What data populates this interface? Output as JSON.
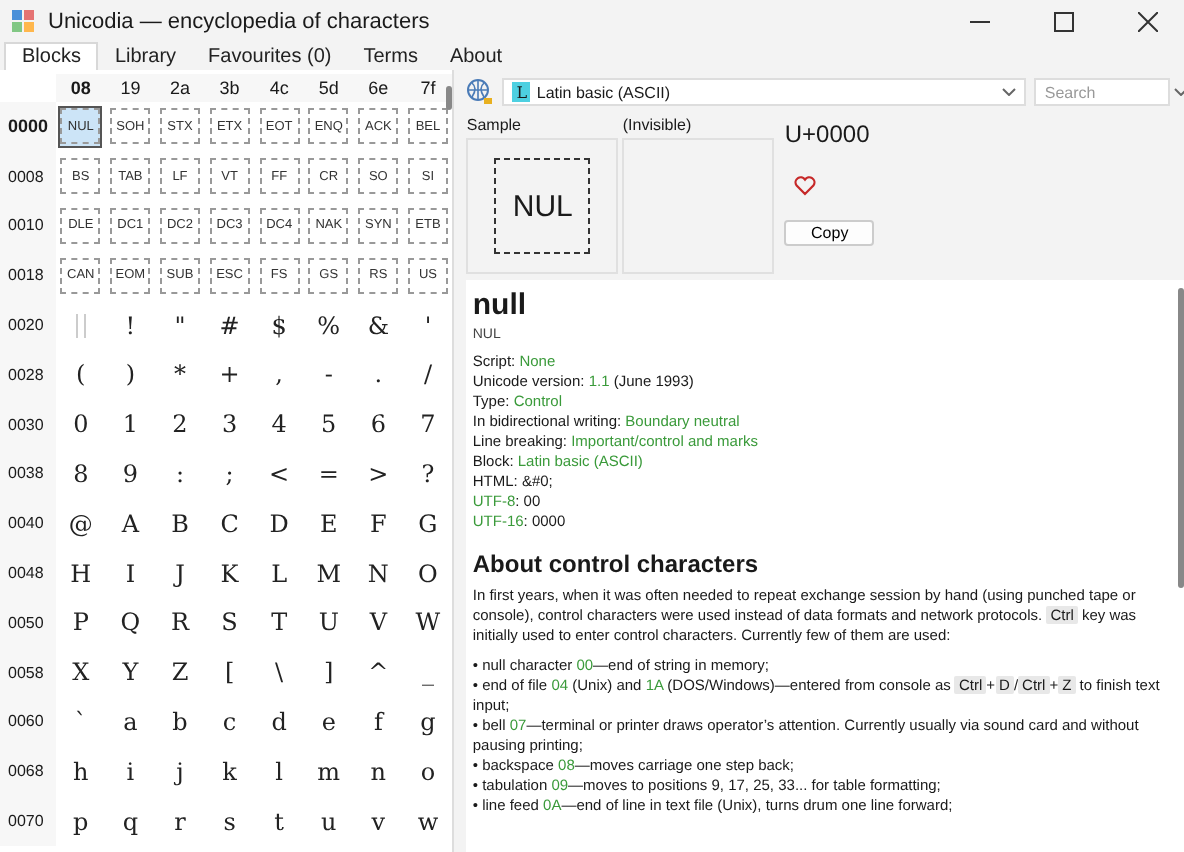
{
  "window": {
    "title": "Unicodia — encyclopedia of characters"
  },
  "tabs": [
    {
      "label": "Blocks",
      "selected": true
    },
    {
      "label": "Library",
      "selected": false
    },
    {
      "label": "Favourites (0)",
      "selected": false
    },
    {
      "label": "Terms",
      "selected": false
    },
    {
      "label": "About",
      "selected": false
    }
  ],
  "grid": {
    "columns": [
      {
        "label": "08",
        "selected": true
      },
      {
        "label": "19",
        "selected": false
      },
      {
        "label": "2a",
        "selected": false
      },
      {
        "label": "3b",
        "selected": false
      },
      {
        "label": "4c",
        "selected": false
      },
      {
        "label": "5d",
        "selected": false
      },
      {
        "label": "6e",
        "selected": false
      },
      {
        "label": "7f",
        "selected": false
      }
    ],
    "rows": [
      {
        "code": "0000",
        "selected": true,
        "cells": [
          {
            "kind": "control",
            "text": "NUL",
            "selected": true
          },
          {
            "kind": "control",
            "text": "SOH",
            "selected": false
          },
          {
            "kind": "control",
            "text": "STX",
            "selected": false
          },
          {
            "kind": "control",
            "text": "ETX",
            "selected": false
          },
          {
            "kind": "control",
            "text": "EOT",
            "selected": false
          },
          {
            "kind": "control",
            "text": "ENQ",
            "selected": false
          },
          {
            "kind": "control",
            "text": "ACK",
            "selected": false
          },
          {
            "kind": "control",
            "text": "BEL",
            "selected": false
          }
        ]
      },
      {
        "code": "0008",
        "selected": false,
        "cells": [
          {
            "kind": "control",
            "text": "BS",
            "selected": false
          },
          {
            "kind": "control",
            "text": "TAB",
            "selected": false
          },
          {
            "kind": "control",
            "text": "LF",
            "selected": false
          },
          {
            "kind": "control",
            "text": "VT",
            "selected": false
          },
          {
            "kind": "control",
            "text": "FF",
            "selected": false
          },
          {
            "kind": "control",
            "text": "CR",
            "selected": false
          },
          {
            "kind": "control",
            "text": "SO",
            "selected": false
          },
          {
            "kind": "control",
            "text": "SI",
            "selected": false
          }
        ]
      },
      {
        "code": "0010",
        "selected": false,
        "cells": [
          {
            "kind": "control",
            "text": "DLE",
            "selected": false
          },
          {
            "kind": "control",
            "text": "DC1",
            "selected": false
          },
          {
            "kind": "control",
            "text": "DC2",
            "selected": false
          },
          {
            "kind": "control",
            "text": "DC3",
            "selected": false
          },
          {
            "kind": "control",
            "text": "DC4",
            "selected": false
          },
          {
            "kind": "control",
            "text": "NAK",
            "selected": false
          },
          {
            "kind": "control",
            "text": "SYN",
            "selected": false
          },
          {
            "kind": "control",
            "text": "ETB",
            "selected": false
          }
        ]
      },
      {
        "code": "0018",
        "selected": false,
        "cells": [
          {
            "kind": "control",
            "text": "CAN",
            "selected": false
          },
          {
            "kind": "control",
            "text": "EOM",
            "selected": false
          },
          {
            "kind": "control",
            "text": "SUB",
            "selected": false
          },
          {
            "kind": "control",
            "text": "ESC",
            "selected": false
          },
          {
            "kind": "control",
            "text": "FS",
            "selected": false
          },
          {
            "kind": "control",
            "text": "GS",
            "selected": false
          },
          {
            "kind": "control",
            "text": "RS",
            "selected": false
          },
          {
            "kind": "control",
            "text": "US",
            "selected": false
          }
        ]
      },
      {
        "code": "0020",
        "selected": false,
        "cells": [
          {
            "kind": "space",
            "selected": false
          },
          {
            "kind": "glyph",
            "text": "!",
            "selected": false
          },
          {
            "kind": "glyph",
            "text": "\"",
            "selected": false
          },
          {
            "kind": "glyph",
            "text": "#",
            "selected": false
          },
          {
            "kind": "glyph",
            "text": "$",
            "selected": false
          },
          {
            "kind": "glyph",
            "text": "%",
            "selected": false
          },
          {
            "kind": "glyph",
            "text": "&",
            "selected": false
          },
          {
            "kind": "glyph",
            "text": "'",
            "selected": false
          }
        ]
      },
      {
        "code": "0028",
        "selected": false,
        "cells": [
          {
            "kind": "glyph",
            "text": "(",
            "selected": false
          },
          {
            "kind": "glyph",
            "text": ")",
            "selected": false
          },
          {
            "kind": "glyph",
            "text": "*",
            "selected": false
          },
          {
            "kind": "glyph",
            "text": "+",
            "selected": false
          },
          {
            "kind": "glyph",
            "text": ",",
            "selected": false
          },
          {
            "kind": "glyph",
            "text": "-",
            "selected": false
          },
          {
            "kind": "glyph",
            "text": ".",
            "selected": false
          },
          {
            "kind": "glyph",
            "text": "/",
            "selected": false
          }
        ]
      },
      {
        "code": "0030",
        "selected": false,
        "cells": [
          {
            "kind": "glyph",
            "text": "0",
            "selected": false
          },
          {
            "kind": "glyph",
            "text": "1",
            "selected": false
          },
          {
            "kind": "glyph",
            "text": "2",
            "selected": false
          },
          {
            "kind": "glyph",
            "text": "3",
            "selected": false
          },
          {
            "kind": "glyph",
            "text": "4",
            "selected": false
          },
          {
            "kind": "glyph",
            "text": "5",
            "selected": false
          },
          {
            "kind": "glyph",
            "text": "6",
            "selected": false
          },
          {
            "kind": "glyph",
            "text": "7",
            "selected": false
          }
        ]
      },
      {
        "code": "0038",
        "selected": false,
        "cells": [
          {
            "kind": "glyph",
            "text": "8",
            "selected": false
          },
          {
            "kind": "glyph",
            "text": "9",
            "selected": false
          },
          {
            "kind": "glyph",
            "text": ":",
            "selected": false
          },
          {
            "kind": "glyph",
            "text": ";",
            "selected": false
          },
          {
            "kind": "glyph",
            "text": "<",
            "selected": false
          },
          {
            "kind": "glyph",
            "text": "=",
            "selected": false
          },
          {
            "kind": "glyph",
            "text": ">",
            "selected": false
          },
          {
            "kind": "glyph",
            "text": "?",
            "selected": false
          }
        ]
      },
      {
        "code": "0040",
        "selected": false,
        "cells": [
          {
            "kind": "glyph",
            "text": "@",
            "selected": false
          },
          {
            "kind": "glyph",
            "text": "A",
            "selected": false
          },
          {
            "kind": "glyph",
            "text": "B",
            "selected": false
          },
          {
            "kind": "glyph",
            "text": "C",
            "selected": false
          },
          {
            "kind": "glyph",
            "text": "D",
            "selected": false
          },
          {
            "kind": "glyph",
            "text": "E",
            "selected": false
          },
          {
            "kind": "glyph",
            "text": "F",
            "selected": false
          },
          {
            "kind": "glyph",
            "text": "G",
            "selected": false
          }
        ]
      },
      {
        "code": "0048",
        "selected": false,
        "cells": [
          {
            "kind": "glyph",
            "text": "H",
            "selected": false
          },
          {
            "kind": "glyph",
            "text": "I",
            "selected": false
          },
          {
            "kind": "glyph",
            "text": "J",
            "selected": false
          },
          {
            "kind": "glyph",
            "text": "K",
            "selected": false
          },
          {
            "kind": "glyph",
            "text": "L",
            "selected": false
          },
          {
            "kind": "glyph",
            "text": "M",
            "selected": false
          },
          {
            "kind": "glyph",
            "text": "N",
            "selected": false
          },
          {
            "kind": "glyph",
            "text": "O",
            "selected": false
          }
        ]
      },
      {
        "code": "0050",
        "selected": false,
        "cells": [
          {
            "kind": "glyph",
            "text": "P",
            "selected": false
          },
          {
            "kind": "glyph",
            "text": "Q",
            "selected": false
          },
          {
            "kind": "glyph",
            "text": "R",
            "selected": false
          },
          {
            "kind": "glyph",
            "text": "S",
            "selected": false
          },
          {
            "kind": "glyph",
            "text": "T",
            "selected": false
          },
          {
            "kind": "glyph",
            "text": "U",
            "selected": false
          },
          {
            "kind": "glyph",
            "text": "V",
            "selected": false
          },
          {
            "kind": "glyph",
            "text": "W",
            "selected": false
          }
        ]
      },
      {
        "code": "0058",
        "selected": false,
        "cells": [
          {
            "kind": "glyph",
            "text": "X",
            "selected": false
          },
          {
            "kind": "glyph",
            "text": "Y",
            "selected": false
          },
          {
            "kind": "glyph",
            "text": "Z",
            "selected": false
          },
          {
            "kind": "glyph",
            "text": "[",
            "selected": false
          },
          {
            "kind": "glyph",
            "text": "\\",
            "selected": false
          },
          {
            "kind": "glyph",
            "text": "]",
            "selected": false
          },
          {
            "kind": "glyph",
            "text": "^",
            "selected": false
          },
          {
            "kind": "glyph",
            "text": "_",
            "selected": false
          }
        ]
      },
      {
        "code": "0060",
        "selected": false,
        "cells": [
          {
            "kind": "glyph",
            "text": "`",
            "selected": false
          },
          {
            "kind": "glyph",
            "text": "a",
            "selected": false
          },
          {
            "kind": "glyph",
            "text": "b",
            "selected": false
          },
          {
            "kind": "glyph",
            "text": "c",
            "selected": false
          },
          {
            "kind": "glyph",
            "text": "d",
            "selected": false
          },
          {
            "kind": "glyph",
            "text": "e",
            "selected": false
          },
          {
            "kind": "glyph",
            "text": "f",
            "selected": false
          },
          {
            "kind": "glyph",
            "text": "g",
            "selected": false
          }
        ]
      },
      {
        "code": "0068",
        "selected": false,
        "cells": [
          {
            "kind": "glyph",
            "text": "h",
            "selected": false
          },
          {
            "kind": "glyph",
            "text": "i",
            "selected": false
          },
          {
            "kind": "glyph",
            "text": "j",
            "selected": false
          },
          {
            "kind": "glyph",
            "text": "k",
            "selected": false
          },
          {
            "kind": "glyph",
            "text": "l",
            "selected": false
          },
          {
            "kind": "glyph",
            "text": "m",
            "selected": false
          },
          {
            "kind": "glyph",
            "text": "n",
            "selected": false
          },
          {
            "kind": "glyph",
            "text": "o",
            "selected": false
          }
        ]
      },
      {
        "code": "0070",
        "selected": false,
        "cells": [
          {
            "kind": "glyph",
            "text": "p",
            "selected": false
          },
          {
            "kind": "glyph",
            "text": "q",
            "selected": false
          },
          {
            "kind": "glyph",
            "text": "r",
            "selected": false
          },
          {
            "kind": "glyph",
            "text": "s",
            "selected": false
          },
          {
            "kind": "glyph",
            "text": "t",
            "selected": false
          },
          {
            "kind": "glyph",
            "text": "u",
            "selected": false
          },
          {
            "kind": "glyph",
            "text": "v",
            "selected": false
          },
          {
            "kind": "glyph",
            "text": "w",
            "selected": false
          }
        ]
      }
    ]
  },
  "toolbar": {
    "block": {
      "letter": "L",
      "value": "Latin basic (ASCII)"
    },
    "search": {
      "placeholder": "Search"
    }
  },
  "sample": {
    "label": "Sample",
    "glyph": "NUL",
    "invisible_label": "(Invisible)",
    "code": "U+0000",
    "favourite": false,
    "copy_button": "Copy"
  },
  "info": {
    "title": "null",
    "abbreviation": "NUL",
    "properties": [
      [
        {
          "kind": "text",
          "text": "Script: "
        },
        {
          "kind": "link",
          "text": "None"
        }
      ],
      [
        {
          "kind": "text",
          "text": "Unicode version: "
        },
        {
          "kind": "link",
          "text": "1.1"
        },
        {
          "kind": "text",
          "text": " (June 1993)"
        }
      ],
      [
        {
          "kind": "text",
          "text": "Type: "
        },
        {
          "kind": "link",
          "text": "Control"
        }
      ],
      [
        {
          "kind": "text",
          "text": "In bidirectional writing: "
        },
        {
          "kind": "link",
          "text": "Boundary neutral"
        }
      ],
      [
        {
          "kind": "text",
          "text": "Line breaking: "
        },
        {
          "kind": "link",
          "text": "Important/control and marks"
        }
      ],
      [
        {
          "kind": "text",
          "text": "Block: "
        },
        {
          "kind": "link",
          "text": "Latin basic (ASCII)"
        }
      ],
      [
        {
          "kind": "text",
          "text": "HTML: &#0;"
        }
      ],
      [
        {
          "kind": "link",
          "text": "UTF-8"
        },
        {
          "kind": "text",
          "text": ": 00"
        }
      ],
      [
        {
          "kind": "link",
          "text": "UTF-16"
        },
        {
          "kind": "text",
          "text": ": 0000"
        }
      ]
    ],
    "section_title": "About control characters",
    "paragraphs": [
      [
        {
          "kind": "text",
          "text": "In first years, when it was often needed to repeat exchange session by hand (using punched tape or console), control characters were used instead of data formats and network protocols. "
        },
        {
          "kind": "key",
          "text": "Ctrl"
        },
        {
          "kind": "text",
          "text": " key was initially used to enter control characters. Currently few of them are used:"
        }
      ],
      [
        {
          "kind": "text",
          "text": "• null character "
        },
        {
          "kind": "link",
          "text": "00"
        },
        {
          "kind": "text",
          "text": "—end of string in memory;"
        }
      ],
      [
        {
          "kind": "text",
          "text": "• end of file "
        },
        {
          "kind": "link",
          "text": "04"
        },
        {
          "kind": "text",
          "text": " (Unix) and "
        },
        {
          "kind": "link",
          "text": "1A"
        },
        {
          "kind": "text",
          "text": " (DOS/Windows)—entered from console as "
        },
        {
          "kind": "key",
          "text": "Ctrl"
        },
        {
          "kind": "text",
          "text": "+"
        },
        {
          "kind": "key",
          "text": "D"
        },
        {
          "kind": "text",
          "text": "/"
        },
        {
          "kind": "key",
          "text": "Ctrl"
        },
        {
          "kind": "text",
          "text": "+"
        },
        {
          "kind": "key",
          "text": "Z"
        },
        {
          "kind": "text",
          "text": " to finish text input;"
        }
      ],
      [
        {
          "kind": "text",
          "text": "• bell "
        },
        {
          "kind": "link",
          "text": "07"
        },
        {
          "kind": "text",
          "text": "—terminal or printer draws operator’s attention. Currently usually via sound card and without pausing printing;"
        }
      ],
      [
        {
          "kind": "text",
          "text": "• backspace "
        },
        {
          "kind": "link",
          "text": "08"
        },
        {
          "kind": "text",
          "text": "—moves carriage one step back;"
        }
      ],
      [
        {
          "kind": "text",
          "text": "• tabulation "
        },
        {
          "kind": "link",
          "text": "09"
        },
        {
          "kind": "text",
          "text": "—moves to positions 9, 17, 25, 33... for table formatting;"
        }
      ],
      [
        {
          "kind": "text",
          "text": "• line feed "
        },
        {
          "kind": "link",
          "text": "0A"
        },
        {
          "kind": "text",
          "text": "—end of line in text file (Unix), turns drum one line forward;"
        }
      ]
    ]
  }
}
